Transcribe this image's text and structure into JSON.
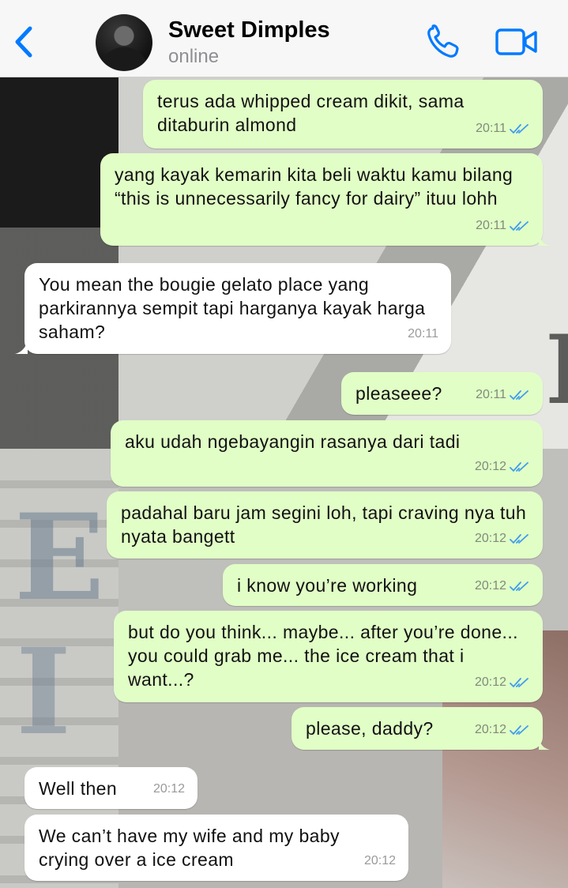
{
  "header": {
    "name": "Sweet Dimples",
    "status": "online",
    "icons": [
      "chevron-left-icon",
      "phone-icon",
      "video-camera-icon"
    ],
    "accent_color": "#007aff"
  },
  "colors": {
    "outgoing": "#e1fec6",
    "incoming": "#ffffff",
    "ticks": "#3e9bf0"
  },
  "messages": [
    {
      "direction": "out",
      "text": "terus ada whipped cream dikit, sama ditaburin almond",
      "time": "20:11"
    },
    {
      "direction": "out",
      "text": "yang kayak kemarin kita beli waktu kamu bilang “this is unnecessarily fancy for dairy” ituu lohh",
      "time": "20:11"
    },
    {
      "direction": "in",
      "text": "You mean the bougie gelato place yang parkirannya sempit tapi harganya kayak harga saham?",
      "time": "20:11"
    },
    {
      "direction": "out",
      "text": "pleaseee?",
      "time": "20:11"
    },
    {
      "direction": "out",
      "text": "aku udah ngebayangin rasanya dari tadi",
      "time": "20:12"
    },
    {
      "direction": "out",
      "text": "padahal baru jam segini loh, tapi craving nya tuh nyata bangett",
      "time": "20:12"
    },
    {
      "direction": "out",
      "text": "i know you’re working",
      "time": "20:12"
    },
    {
      "direction": "out",
      "text": "but do you think... maybe... after you’re done... you could grab me... the ice cream that i want...?",
      "time": "20:12"
    },
    {
      "direction": "out",
      "text": "please, daddy?",
      "time": "20:12"
    },
    {
      "direction": "in",
      "text": "Well then",
      "time": "20:12"
    },
    {
      "direction": "in",
      "text": "We can’t have my wife and my baby crying over a ice cream",
      "time": "20:12"
    }
  ]
}
